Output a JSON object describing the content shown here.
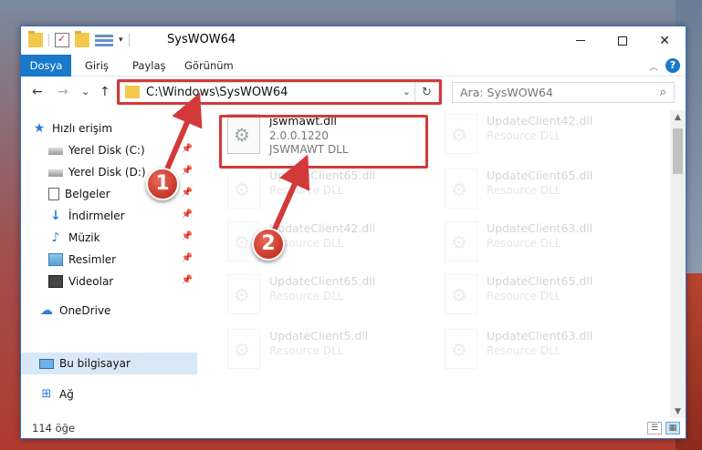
{
  "window": {
    "title": "SysWOW64",
    "buttons": {
      "minimize": "minimize",
      "maximize": "maximize",
      "close": "✕"
    }
  },
  "ribbon": {
    "tabs": [
      "Dosya",
      "Giriş",
      "Paylaş",
      "Görünüm"
    ],
    "help": "?"
  },
  "nav": {
    "back": "←",
    "forward": "→",
    "recent": "⌄",
    "up": "↑",
    "address": "C:\\Windows\\SysWOW64",
    "search_placeholder": "Ara: SysWOW64"
  },
  "sidebar": {
    "items": [
      {
        "label": "Hızlı erişim",
        "icon": "star-icon"
      },
      {
        "label": "Yerel Disk (C:)",
        "icon": "drive-icon",
        "pinned": true
      },
      {
        "label": "Yerel Disk (D:)",
        "icon": "drive-icon",
        "pinned": true
      },
      {
        "label": "Belgeler",
        "icon": "document-icon",
        "pinned": true
      },
      {
        "label": "İndirmeler",
        "icon": "download-icon",
        "pinned": true
      },
      {
        "label": "Müzik",
        "icon": "music-icon",
        "pinned": true
      },
      {
        "label": "Resimler",
        "icon": "picture-icon",
        "pinned": true
      },
      {
        "label": "Videolar",
        "icon": "video-icon",
        "pinned": true
      },
      {
        "label": "OneDrive",
        "icon": "cloud-icon"
      },
      {
        "label": "Bu bilgisayar",
        "icon": "computer-icon",
        "selected": true
      },
      {
        "label": "Ağ",
        "icon": "network-icon"
      }
    ]
  },
  "files": [
    {
      "name": "jswmawt.dll",
      "version": "2.0.0.1220",
      "description": "JSWMAWT DLL",
      "highlighted": true
    },
    {
      "name": "UpdateClient42.dll",
      "version": "",
      "description": "Resource DLL"
    },
    {
      "name": "UpdateClient65.dll",
      "version": "",
      "description": "Resource DLL"
    },
    {
      "name": "UpdateClient65.dll",
      "version": "",
      "description": "Resource DLL"
    },
    {
      "name": "UpdateClient42.dll",
      "version": "",
      "description": "Resource DLL"
    },
    {
      "name": "UpdateClient63.dll",
      "version": "",
      "description": "Resource DLL"
    },
    {
      "name": "UpdateClient65.dll",
      "version": "",
      "description": "Resource DLL"
    },
    {
      "name": "UpdateClient65.dll",
      "version": "",
      "description": "Resource DLL"
    },
    {
      "name": "UpdateClient5.dll",
      "version": "",
      "description": "Resource DLL"
    },
    {
      "name": "UpdateClient63.dll",
      "version": "",
      "description": "Resource DLL"
    }
  ],
  "status": {
    "count": "114 öğe"
  },
  "annotations": {
    "step1": "1",
    "step2": "2"
  },
  "colors": {
    "accent": "#1979ca",
    "highlight": "#d23a3a",
    "badge": "#c83628"
  }
}
